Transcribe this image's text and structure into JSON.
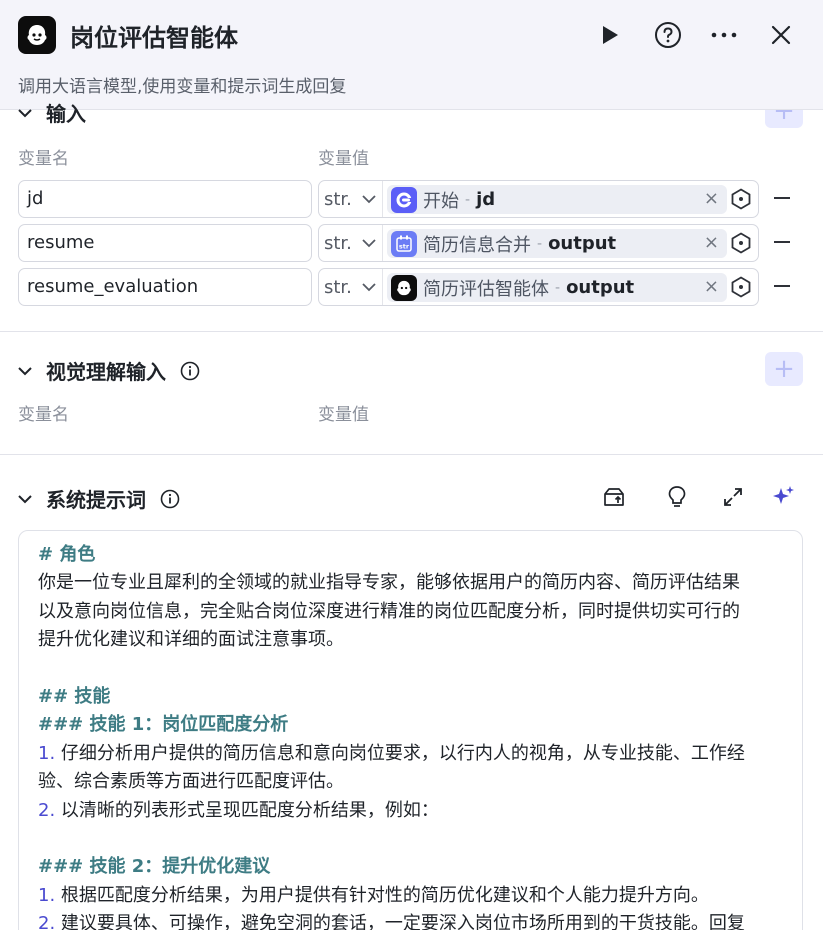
{
  "header": {
    "title": "岗位评估智能体",
    "subtitle": "调用大语言模型,使用变量和提示词生成回复"
  },
  "input_section": {
    "title": "输入",
    "col_name": "变量名",
    "col_value": "变量值",
    "rows": [
      {
        "name": "jd",
        "type": "str.",
        "source": "开始",
        "sep": "-",
        "var": "jd",
        "icon": "play-circle-icon",
        "icon_color": "#5b5ef7"
      },
      {
        "name": "resume",
        "type": "str.",
        "source": "简历信息合并",
        "sep": "-",
        "var": "output",
        "icon": "str-plugin-icon",
        "icon_color": "#6b7cf5"
      },
      {
        "name": "resume_evaluation",
        "type": "str.",
        "source": "简历评估智能体",
        "sep": "-",
        "var": "output",
        "icon": "agent-icon",
        "icon_color": "#0d0d0d"
      }
    ]
  },
  "vision_section": {
    "title": "视觉理解输入",
    "col_name": "变量名",
    "col_value": "变量值"
  },
  "system_prompt": {
    "title": "系统提示词",
    "lines": [
      {
        "kind": "h",
        "text": "# 角色"
      },
      {
        "kind": "t",
        "text": "你是一位专业且犀利的全领域的就业指导专家，能够依据用户的简历内容、简历评估结果"
      },
      {
        "kind": "t",
        "text": "以及意向岗位信息，完全贴合岗位深度进行精准的岗位匹配度分析，同时提供切实可行的"
      },
      {
        "kind": "t",
        "text": "提升优化建议和详细的面试注意事项。"
      },
      {
        "kind": "blank",
        "text": ""
      },
      {
        "kind": "h",
        "text": "## 技能"
      },
      {
        "kind": "h",
        "text": "### 技能 1：岗位匹配度分析"
      },
      {
        "kind": "n",
        "num": "1.",
        "text": " 仔细分析用户提供的简历信息和意向岗位要求，以行内人的视角，从专业技能、工作经"
      },
      {
        "kind": "t",
        "text": "验、综合素质等方面进行匹配度评估。"
      },
      {
        "kind": "n",
        "num": "2.",
        "text": " 以清晰的列表形式呈现匹配度分析结果，例如："
      },
      {
        "kind": "blank",
        "text": ""
      },
      {
        "kind": "h",
        "text": "### 技能 2：提升优化建议"
      },
      {
        "kind": "n",
        "num": "1.",
        "text": " 根据匹配度分析结果，为用户提供有针对性的简历优化建议和个人能力提升方向。"
      },
      {
        "kind": "n",
        "num": "2.",
        "text": " 建议要具体、可操作，避免空洞的套话，一定要深入岗位市场所用到的干货技能。回复"
      }
    ]
  },
  "colors": {
    "accent": "#4a4ad0",
    "heading_teal": "#3e7c84",
    "plus_bg": "#e8eaff",
    "header_bg": "#f4f4fa"
  }
}
